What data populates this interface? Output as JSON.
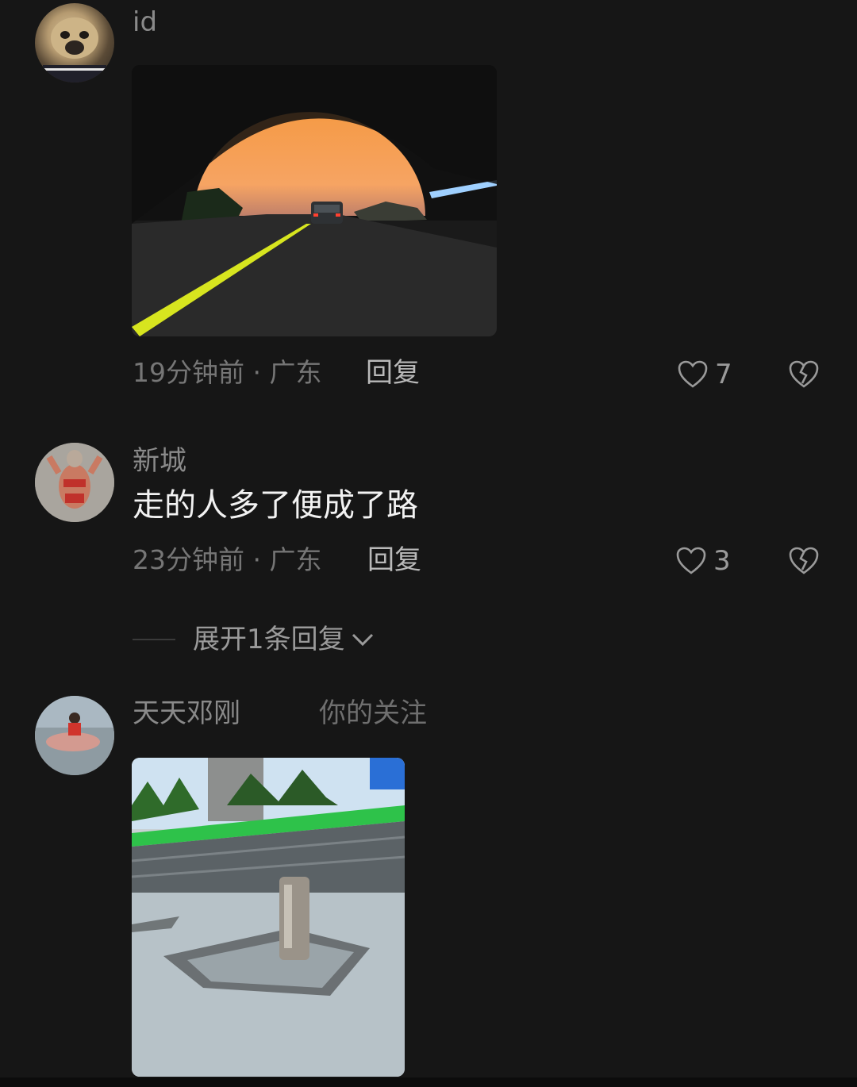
{
  "comments": [
    {
      "username": "id",
      "image_alt": "tunnel at sunset with car",
      "time": "19分钟前",
      "location": "广东",
      "reply_label": "回复",
      "likes": "7"
    },
    {
      "username": "新城",
      "text": "走的人多了便成了路",
      "time": "23分钟前",
      "location": "广东",
      "reply_label": "回复",
      "likes": "3",
      "expand_label": "展开1条回复"
    },
    {
      "username": "天天邓刚",
      "follow_tag": "你的关注",
      "image_alt": "construction site with concrete pillar"
    }
  ],
  "icons": {
    "like": "heart-icon",
    "dislike": "broken-heart-icon",
    "expand": "chevron-down-icon"
  },
  "colors": {
    "background": "#161616",
    "text_primary": "#f2f2f2",
    "text_secondary": "#8a8a8a"
  }
}
